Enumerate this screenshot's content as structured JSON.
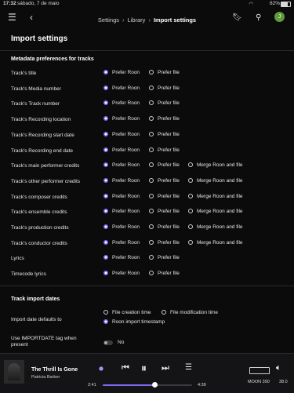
{
  "status_bar": {
    "time": "17:32",
    "date": "sábado, 7 de maio",
    "battery": "82%"
  },
  "header": {
    "breadcrumbs": [
      "Settings",
      "Library",
      "Import settings"
    ],
    "avatar_letter": "J"
  },
  "page": {
    "title": "Import settings"
  },
  "metadata": {
    "heading": "Metadata preferences for tracks",
    "option_labels": {
      "roon": "Prefer Roon",
      "file": "Prefer file",
      "merge": "Merge Roon and file"
    },
    "rows": [
      {
        "label": "Track's title"
      },
      {
        "label": "Track's Media number"
      },
      {
        "label": "Track's Track number"
      },
      {
        "label": "Track's Recording location"
      },
      {
        "label": "Track's Recording start date"
      },
      {
        "label": "Track's Recording end date"
      },
      {
        "label": "Track's main performer credits"
      },
      {
        "label": "Track's other performer credits"
      },
      {
        "label": "Track's composer credits"
      },
      {
        "label": "Track's ensemble credits"
      },
      {
        "label": "Track's production credits"
      },
      {
        "label": "Track's conductor credits"
      },
      {
        "label": "Lyrics"
      },
      {
        "label": "Timecode lyrics"
      }
    ]
  },
  "import_dates": {
    "heading": "Track import dates",
    "default_label": "Import date defaults to",
    "options": {
      "creation": "File creation time",
      "modification": "File modification time",
      "roon": "Roon import timestamp"
    },
    "tag_label_1": "Use IMPORTDATE tag when",
    "tag_label_2": "present",
    "tag_toggle": "No"
  },
  "player": {
    "title": "The Thrill Is Gone",
    "artist": "Patricia Barber",
    "elapsed": "2:41",
    "total": "4:39",
    "zone": "MOON 390",
    "volume": "38.0"
  }
}
